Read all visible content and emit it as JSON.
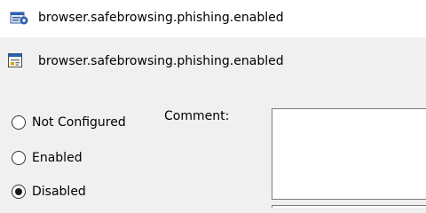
{
  "window": {
    "title": "browser.safebrowsing.phishing.enabled",
    "icon": "policy-window-icon"
  },
  "header": {
    "title": "browser.safebrowsing.phishing.enabled",
    "icon": "policy-setting-icon"
  },
  "state": {
    "options": [
      {
        "label": "Not Configured",
        "checked": false
      },
      {
        "label": "Enabled",
        "checked": false
      },
      {
        "label": "Disabled",
        "checked": true
      }
    ],
    "selected": "Disabled"
  },
  "comment": {
    "label": "Comment:",
    "value": ""
  },
  "colors": {
    "window_bg": "#f0f0f0",
    "titlebar_bg": "#ffffff",
    "icon_blue": "#2b5fae"
  }
}
